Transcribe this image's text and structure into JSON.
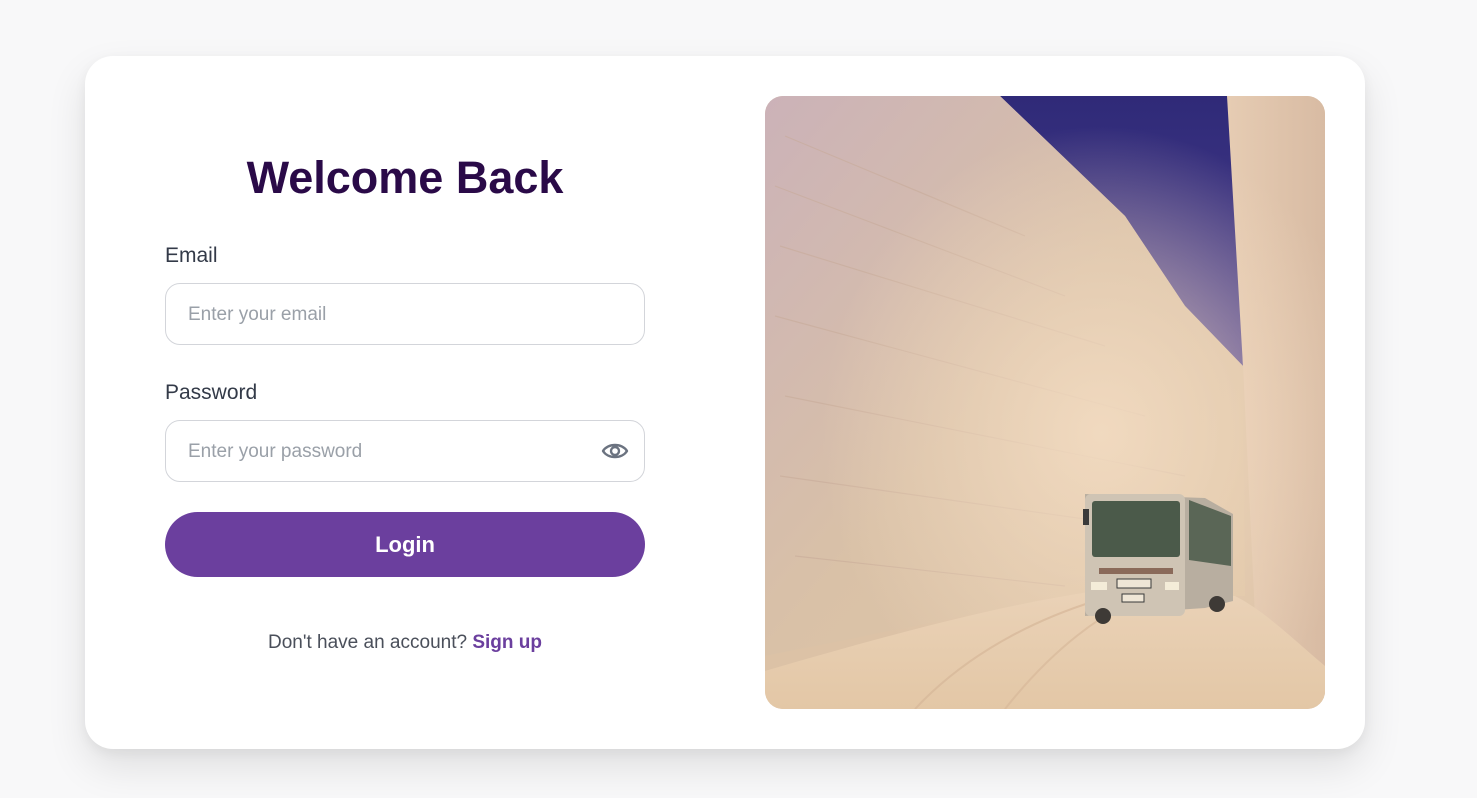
{
  "login": {
    "title": "Welcome Back",
    "email_label": "Email",
    "email_placeholder": "Enter your email",
    "password_label": "Password",
    "password_placeholder": "Enter your password",
    "login_label": "Login",
    "signup_prompt": "Don't have an account?",
    "signup_link": "Sign up"
  },
  "icons": {
    "password_toggle": "eye-icon"
  },
  "colors": {
    "title": "#2a0a48",
    "accent": "#6b3f9e",
    "background": "#f8f8f9",
    "card": "#ffffff"
  }
}
